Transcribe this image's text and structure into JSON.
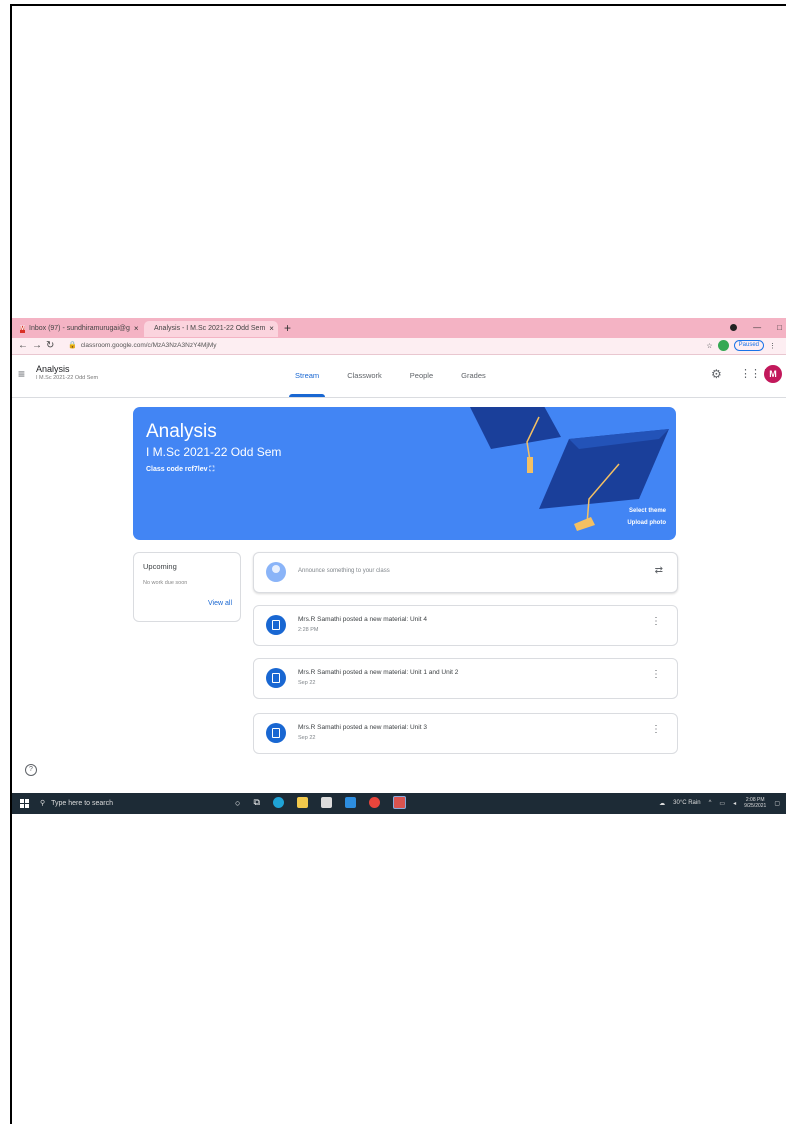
{
  "browser": {
    "tabs": [
      {
        "label": "Inbox (97) - sundhiramurugai@g",
        "close": "×"
      },
      {
        "label": "Analysis - I M.Sc 2021-22 Odd Sem",
        "close": "×"
      }
    ],
    "new_tab": "+",
    "url": "classroom.google.com/c/MzA3NzA3NzY4MjMy"
  },
  "header": {
    "class_title": "Analysis",
    "class_subtitle": "I M.Sc 2021-22 Odd Sem",
    "tabs": [
      "Stream",
      "Classwork",
      "People",
      "Grades"
    ],
    "active_tab": "Stream",
    "avatar_letter": "M"
  },
  "banner": {
    "title": "Analysis",
    "subtitle": "I M.Sc 2021-22 Odd Sem",
    "class_code": "Class code  rcf7lev ⛶",
    "select_theme": "Select theme",
    "upload_photo": "Upload photo",
    "color": "#4285f4"
  },
  "upcoming": {
    "title": "Upcoming",
    "empty_text": "No work due soon",
    "view_all": "View all"
  },
  "announce": {
    "placeholder": "Announce something to your class"
  },
  "posts": [
    {
      "title": "Mrs.R Samathi posted a new material: Unit 4",
      "date": "2:28 PM"
    },
    {
      "title": "Mrs.R Samathi posted a new material: Unit 1 and Unit 2",
      "date": "Sep 22"
    },
    {
      "title": "Mrs.R Samathi posted a new material: Unit 3",
      "date": "Sep 22"
    }
  ],
  "taskbar": {
    "search_placeholder": "Type here to search",
    "weather": "30°C Rain",
    "time": "2:08 PM",
    "date": "9/25/2021"
  }
}
